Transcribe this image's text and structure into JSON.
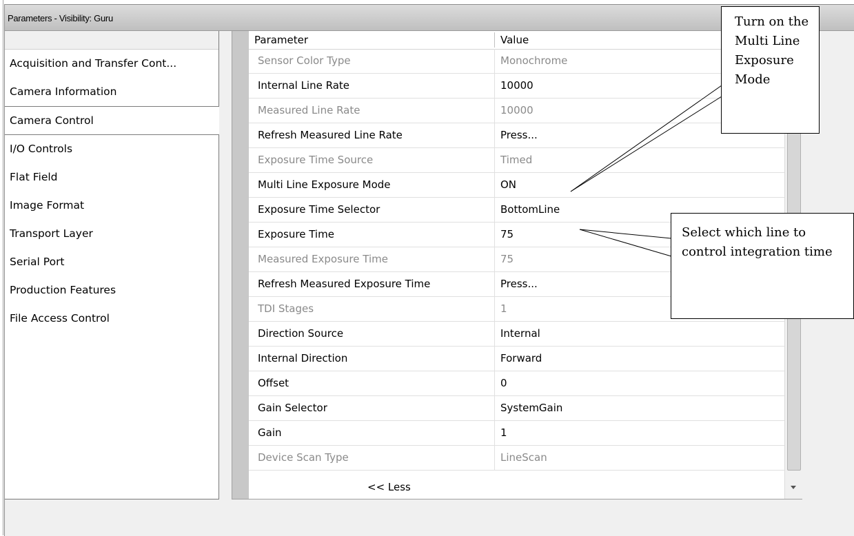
{
  "window": {
    "title": "Parameters - Visibility: Guru"
  },
  "categories": [
    {
      "label": "Acquisition and Transfer Cont...",
      "selected": false
    },
    {
      "label": "Camera Information",
      "selected": false
    },
    {
      "label": "Camera Control",
      "selected": true
    },
    {
      "label": "I/O Controls",
      "selected": false
    },
    {
      "label": "Flat Field",
      "selected": false
    },
    {
      "label": "Image Format",
      "selected": false
    },
    {
      "label": "Transport Layer",
      "selected": false
    },
    {
      "label": "Serial Port",
      "selected": false
    },
    {
      "label": "Production Features",
      "selected": false
    },
    {
      "label": "File Access Control",
      "selected": false
    }
  ],
  "grid": {
    "columns": {
      "parameter": "Parameter",
      "value": "Value"
    },
    "rows": [
      {
        "parameter": "Sensor Color Type",
        "value": "Monochrome",
        "readonly": true
      },
      {
        "parameter": "Internal Line Rate",
        "value": "10000",
        "readonly": false
      },
      {
        "parameter": "Measured Line Rate",
        "value": "10000",
        "readonly": true
      },
      {
        "parameter": "Refresh Measured Line Rate",
        "value": "Press...",
        "readonly": false
      },
      {
        "parameter": "Exposure Time Source",
        "value": "Timed",
        "readonly": true
      },
      {
        "parameter": "Multi Line Exposure Mode",
        "value": "ON",
        "readonly": false
      },
      {
        "parameter": "Exposure Time Selector",
        "value": "BottomLine",
        "readonly": false
      },
      {
        "parameter": "Exposure Time",
        "value": "75",
        "readonly": false
      },
      {
        "parameter": "Measured Exposure Time",
        "value": "75",
        "readonly": true
      },
      {
        "parameter": "Refresh Measured Exposure Time",
        "value": "Press...",
        "readonly": false
      },
      {
        "parameter": "TDI Stages",
        "value": "1",
        "readonly": true
      },
      {
        "parameter": "Direction Source",
        "value": "Internal",
        "readonly": false
      },
      {
        "parameter": "Internal Direction",
        "value": "Forward",
        "readonly": false
      },
      {
        "parameter": "Offset",
        "value": "0",
        "readonly": false
      },
      {
        "parameter": "Gain Selector",
        "value": "SystemGain",
        "readonly": false
      },
      {
        "parameter": "Gain",
        "value": "1",
        "readonly": false
      },
      {
        "parameter": "Device Scan Type",
        "value": "LineScan",
        "readonly": true
      }
    ],
    "less_label": "<< Less"
  },
  "callouts": {
    "multi_line": "Turn on the Multi Line Exposure Mode",
    "select_line": "Select which line to control integration time"
  }
}
